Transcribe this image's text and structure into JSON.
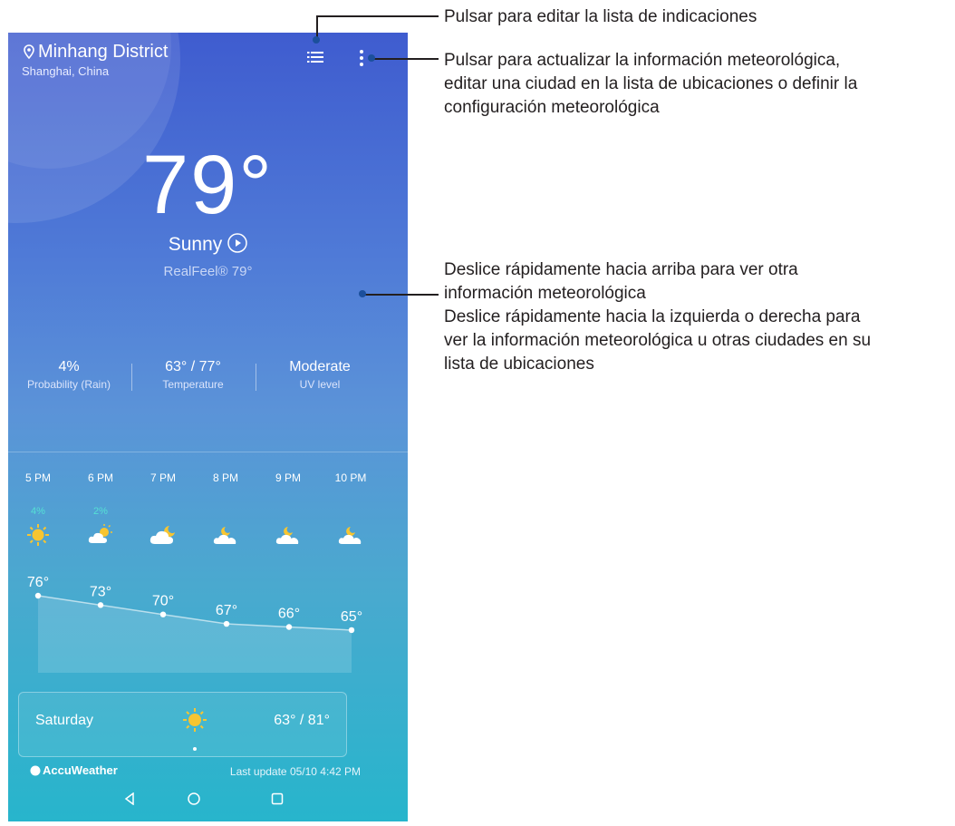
{
  "header": {
    "location": "Minhang District",
    "sublocation": "Shanghai, China"
  },
  "current": {
    "temperature": "79°",
    "condition": "Sunny",
    "realfeel": "RealFeel® 79°"
  },
  "stats": [
    {
      "value": "4%",
      "label": "Probability (Rain)"
    },
    {
      "value": "63° / 77°",
      "label": "Temperature"
    },
    {
      "value": "Moderate",
      "label": "UV level"
    }
  ],
  "hourly": [
    {
      "time": "5 PM",
      "precip": "4%",
      "icon": "sun-icon",
      "temp": "76°",
      "value": 76
    },
    {
      "time": "6 PM",
      "precip": "2%",
      "icon": "partly-cloudy-icon",
      "temp": "73°",
      "value": 73
    },
    {
      "time": "7 PM",
      "precip": "",
      "icon": "cloudy-night-icon",
      "temp": "70°",
      "value": 70
    },
    {
      "time": "8 PM",
      "precip": "",
      "icon": "cloudy-moon-icon",
      "temp": "67°",
      "value": 67
    },
    {
      "time": "9 PM",
      "precip": "",
      "icon": "cloudy-moon-icon",
      "temp": "66°",
      "value": 66
    },
    {
      "time": "10 PM",
      "precip": "",
      "icon": "cloudy-moon-icon",
      "temp": "65°",
      "value": 65
    }
  ],
  "daily": {
    "day": "Saturday",
    "icon": "sun-icon",
    "temps": "63° / 81°"
  },
  "footer": {
    "brand": "AccuWeather",
    "last_update": "Last update 05/10 4:42 PM"
  },
  "colors": {
    "precip_text": "#55e0d5",
    "callout_dot": "#1b4f9c",
    "sun": "#f7c531"
  },
  "callouts": {
    "list_edit": "Pulsar para editar la lista de indicaciones",
    "menu_lines": [
      "Pulsar para actualizar la información meteorológica,",
      "editar una ciudad en la lista de ubicaciones o definir la",
      "configuración meteorológica"
    ],
    "swipe_lines": [
      "Deslice rápidamente hacia arriba para ver otra",
      "información meteorológica",
      "Deslice rápidamente hacia la izquierda o derecha para",
      "ver la información meteorológica u otras ciudades en su",
      "lista de ubicaciones"
    ]
  }
}
